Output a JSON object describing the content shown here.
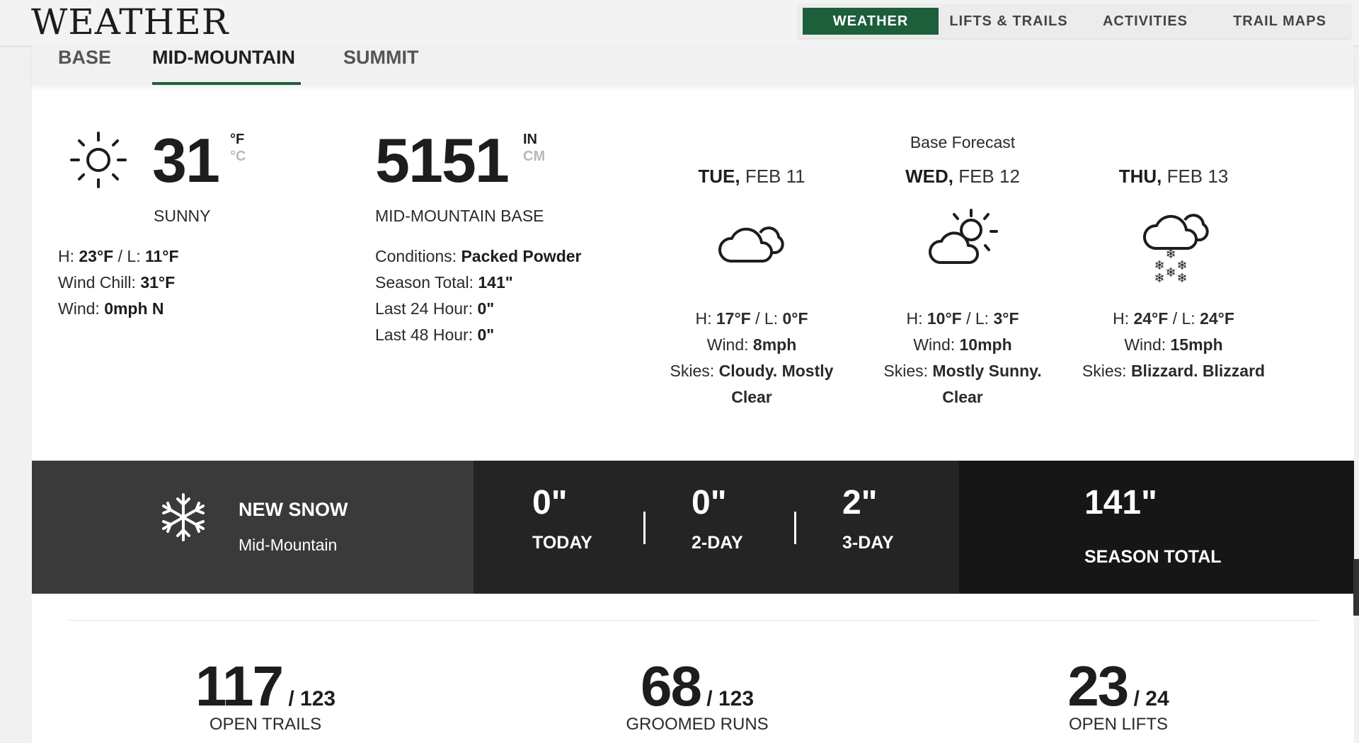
{
  "header": {
    "logo": "WEATHER",
    "nav": [
      {
        "label": "WEATHER"
      },
      {
        "label": "LIFTS & TRAILS"
      },
      {
        "label": "ACTIVITIES"
      },
      {
        "label": "TRAIL MAPS"
      }
    ]
  },
  "tabs": [
    {
      "label": "BASE"
    },
    {
      "label": "MID-MOUNTAIN"
    },
    {
      "label": "SUMMIT"
    }
  ],
  "current": {
    "temp": "31",
    "unit_f": "°F",
    "unit_c": "°C",
    "condition": "SUNNY",
    "hi_label": "H: ",
    "hi": "23°F",
    "lo_label": " / L: ",
    "lo": "11°F",
    "windchill_label": "Wind Chill: ",
    "windchill": "31°F",
    "wind_label": "Wind: ",
    "wind": "0mph N",
    "icon": "sun-icon"
  },
  "snowdepth": {
    "value": "5151",
    "unit_in": "IN",
    "unit_cm": "CM",
    "location": "MID-MOUNTAIN BASE",
    "conditions_label": "Conditions: ",
    "conditions": "Packed Powder",
    "season_label": "Season Total: ",
    "season": "141\"",
    "last24_label": "Last 24 Hour: ",
    "last24": "0\"",
    "last48_label": "Last 48 Hour: ",
    "last48": "0\""
  },
  "forecast": {
    "title": "Base Forecast",
    "days": [
      {
        "dow": "TUE,",
        "date": " FEB 11",
        "hi": "17°F",
        "lo": "0°F",
        "wind": "8mph",
        "skies1": "Cloudy. Mostly",
        "skies2": "Clear",
        "icon": "cloudy-icon"
      },
      {
        "dow": "WED,",
        "date": " FEB 12",
        "hi": "10°F",
        "lo": "3°F",
        "wind": "10mph",
        "skies1": "Mostly Sunny.",
        "skies2": "Clear",
        "icon": "partly-sunny-icon"
      },
      {
        "dow": "THU,",
        "date": " FEB 13",
        "hi": "24°F",
        "lo": "24°F",
        "wind": "15mph",
        "skies1": "Blizzard. Blizzard",
        "skies2": "",
        "icon": "snow-icon"
      }
    ],
    "hi_label": "H: ",
    "lo_label": " / L: ",
    "wind_label": "Wind: ",
    "skies_label": "Skies: "
  },
  "newsnow": {
    "title": "NEW SNOW",
    "location": "Mid-Mountain",
    "today_value": "0\"",
    "today_label": "TODAY",
    "twoday_value": "0\"",
    "twoday_label": "2-DAY",
    "threeday_value": "2\"",
    "threeday_label": "3-DAY",
    "season_value": "141\"",
    "season_label": "SEASON TOTAL"
  },
  "stats": [
    {
      "num": "117",
      "total": " / 123",
      "label": "OPEN TRAILS"
    },
    {
      "num": "68",
      "total": " / 123",
      "label": "GROOMED RUNS"
    },
    {
      "num": "23",
      "total": " / 24",
      "label": "OPEN LIFTS"
    }
  ]
}
